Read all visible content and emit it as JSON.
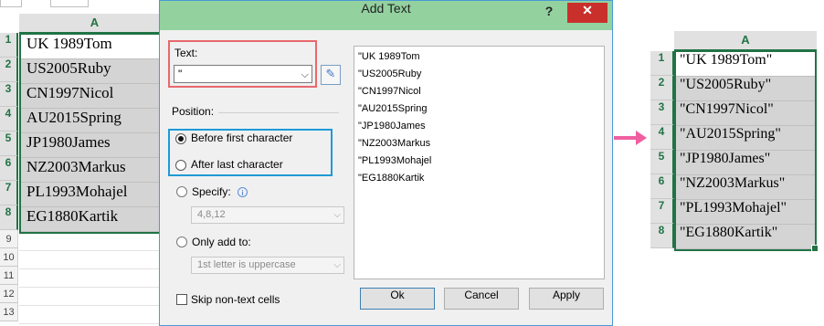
{
  "left_sheet": {
    "column_header": "A",
    "row_numbers": [
      "1",
      "2",
      "3",
      "4",
      "5",
      "6",
      "7",
      "8"
    ],
    "extra_row_numbers": [
      "9",
      "10",
      "11",
      "12",
      "13"
    ],
    "cells": [
      "UK 1989Tom",
      "US2005Ruby",
      "CN1997Nicol",
      "AU2015Spring",
      "JP1980James",
      "NZ2003Markus",
      "PL1993Mohajel",
      "EG1880Kartik"
    ]
  },
  "dialog": {
    "title": "Add Text",
    "help_label": "?",
    "close_label": "✕",
    "text_label": "Text:",
    "text_value": "\"",
    "position_label": "Position:",
    "before_first_label": "Before first character",
    "after_last_label": "After last character",
    "specify_label": "Specify:",
    "specify_value": "4,8,12",
    "only_add_label": "Only add to:",
    "only_add_value": "1st letter is uppercase",
    "skip_label": "Skip non-text cells",
    "preview_items": [
      "\"UK 1989Tom",
      "\"US2005Ruby",
      "\"CN1997Nicol",
      "\"AU2015Spring",
      "\"JP1980James",
      "\"NZ2003Markus",
      "\"PL1993Mohajel",
      "\"EG1880Kartik"
    ],
    "ok_label": "Ok",
    "cancel_label": "Cancel",
    "apply_label": "Apply"
  },
  "right_sheet": {
    "column_header": "A",
    "row_numbers": [
      "1",
      "2",
      "3",
      "4",
      "5",
      "6",
      "7",
      "8"
    ],
    "cells": [
      "\"UK 1989Tom\"",
      "\"US2005Ruby\"",
      "\"CN1997Nicol\"",
      "\"AU2015Spring\"",
      "\"JP1980James\"",
      "\"NZ2003Markus\"",
      "\"PL1993Mohajel\"",
      "\"EG1880Kartik\""
    ]
  },
  "icons": {
    "dropdown": "chevron-down-icon",
    "picker": "eyedropper-icon",
    "info": "info-icon",
    "arrow": "arrow-right-icon"
  },
  "colors": {
    "excel_green": "#217346",
    "titlebar_green": "#93d19f",
    "close_red": "#c9302c",
    "text_group_border": "#e8686d",
    "position_group_border": "#1e9ad6",
    "arrow_pink": "#ef5fa0",
    "selected_cell_fill": "#d4d4d4"
  }
}
